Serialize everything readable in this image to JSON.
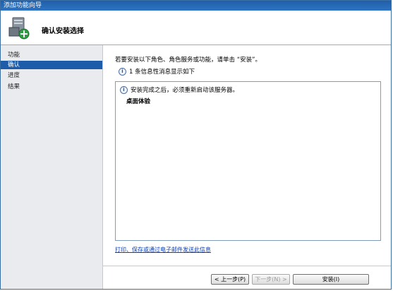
{
  "window": {
    "title": "添加功能向导"
  },
  "header": {
    "title": "确认安装选择"
  },
  "sidebar": {
    "items": [
      {
        "label": "功能",
        "state": "normal"
      },
      {
        "label": "确认",
        "state": "active"
      },
      {
        "label": "进度",
        "state": "normal"
      },
      {
        "label": "结果",
        "state": "normal"
      }
    ]
  },
  "main": {
    "intro": "若要安装以下角色、角色服务或功能，请单击 “安装”。",
    "info_message": "1 条信息性消息显示如下",
    "panel": {
      "notice": "安装完成之后，必须重新启动该服务器。",
      "feature": "桌面体验"
    },
    "link": "打印、保存或通过电子邮件发送此信息"
  },
  "footer": {
    "prev_label": "< 上一步(P)",
    "next_label": "下一步(N) >",
    "install_label": "安装(I)"
  },
  "colors": {
    "accent": "#1c5ca8",
    "title_bar": "#2d74c4",
    "sidebar_bg": "#e9ebee"
  }
}
